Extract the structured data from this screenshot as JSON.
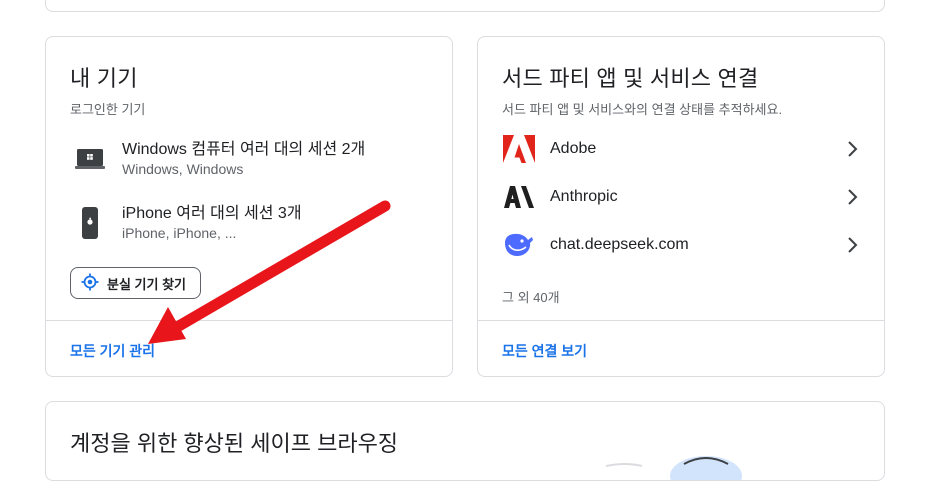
{
  "devices_card": {
    "title": "내 기기",
    "subtitle": "로그인한 기기",
    "devices": [
      {
        "name": "Windows 컴퓨터 여러 대의 세션 2개",
        "meta": "Windows, Windows",
        "icon": "laptop-windows-icon"
      },
      {
        "name": "iPhone 여러 대의 세션 3개",
        "meta": "iPhone, iPhone, ...",
        "icon": "phone-apple-icon"
      }
    ],
    "find_button": "분실 기기 찾기",
    "manage_link": "모든 기기 관리"
  },
  "third_party_card": {
    "title": "서드 파티 앱 및 서비스 연결",
    "subtitle": "서드 파티 앱 및 서비스와의 연결 상태를 추적하세요.",
    "services": [
      {
        "name": "Adobe",
        "icon": "adobe-logo-icon"
      },
      {
        "name": "Anthropic",
        "icon": "anthropic-logo-icon"
      },
      {
        "name": "chat.deepseek.com",
        "icon": "deepseek-logo-icon"
      }
    ],
    "more_text": "그 외 40개",
    "view_link": "모든 연결 보기"
  },
  "browsing_card": {
    "title": "계정을 위한 향상된 세이프 브라우징"
  },
  "colors": {
    "link": "#1a73e8",
    "border": "#dadce0",
    "annotation_arrow": "#e8151b"
  }
}
